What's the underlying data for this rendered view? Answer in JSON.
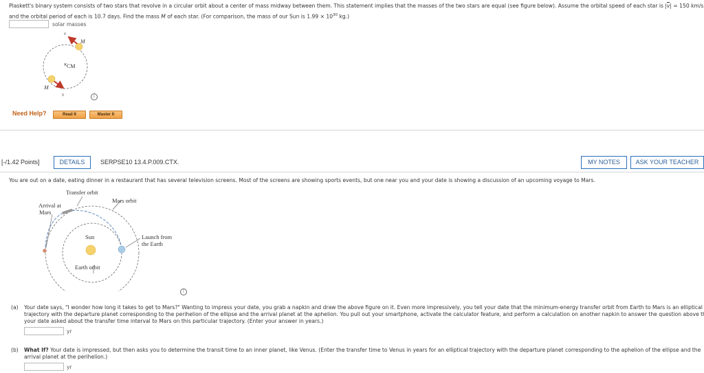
{
  "problem1": {
    "line1": "Plaskett's binary system consists of two stars that revolve in a circular orbit about a center of mass midway between them. This statement implies that the masses of the two stars are equal (see figure below). Assume the orbital speed of each star is |",
    "v_symbol": "v",
    "line1_tail": "| = 150 km/s",
    "line2_a": "and the orbital period of each is 10.7 days. Find the mass ",
    "line2_M": "M",
    "line2_b": " of each star. (For comparison, the mass of our Sun is 1.99 × 10",
    "line2_exp": "30",
    "line2_c": " kg.)",
    "answer_value": "",
    "answer_unit": "solar masses",
    "figure": {
      "label_top_mass": "M",
      "label_bottom_mass": "M",
      "label_cm": "CM",
      "label_v_top": "v",
      "label_v_bottom": "v"
    }
  },
  "help": {
    "label": "Need Help?",
    "read_it": "Read It",
    "master_it": "Master It"
  },
  "problem2": {
    "points": "[-/1.42 Points]",
    "details": "DETAILS",
    "code": "SERPSE10 13.4.P.009.CTX.",
    "my_notes": "MY NOTES",
    "ask_teacher": "ASK YOUR TEACHER",
    "intro": "You are out on a date, eating dinner in a restaurant that has several television screens. Most of the screens are showing sports events, but one near you and your date is showing a discussion of an upcoming voyage to Mars.",
    "figure": {
      "transfer_orbit": "Transfer orbit",
      "mars_orbit": "Mars orbit",
      "arrival_line1": "Arrival at",
      "arrival_line2": "Mars",
      "sun": "Sun",
      "launch_line1": "Launch from",
      "launch_line2": "the Earth",
      "earth_orbit": "Earth orbit"
    },
    "part_a": {
      "tag": "(a)",
      "line1": "Your date says, \"I wonder how long it takes to get to Mars?\" Wanting to impress your date, you grab a napkin and draw the above figure on it. Even more impressively, you tell your date that the minimum-energy transfer orbit from Earth to Mars is an elliptical",
      "line2": "trajectory with the departure planet corresponding to the perihelion of the ellipse and the arrival planet at the aphelion. You pull out your smartphone, activate the calculator feature, and perform a calculation on another napkin to answer the question above that",
      "line3": "your date asked about the transfer time interval to Mars on this particular trajectory. (Enter your answer in years.)",
      "answer_value": "",
      "unit": "yr"
    },
    "part_b": {
      "tag": "(b)",
      "bold": "What If?",
      "line1": " Your date is impressed, but then asks you to determine the transit time to an inner planet, like Venus. (Enter the transfer time to Venus in years for an elliptical trajectory with the departure planet corresponding to the aphelion of the ellipse and the",
      "line2": "arrival planet at the perihelion.)",
      "answer_value": "",
      "unit": "yr"
    }
  },
  "colors": {
    "need_help": "#c0621c",
    "link_blue": "#2a6ebb",
    "arrow_red": "#c0392b",
    "star_yellow": "#f5d26b",
    "earth_blue": "#a9cde8"
  }
}
